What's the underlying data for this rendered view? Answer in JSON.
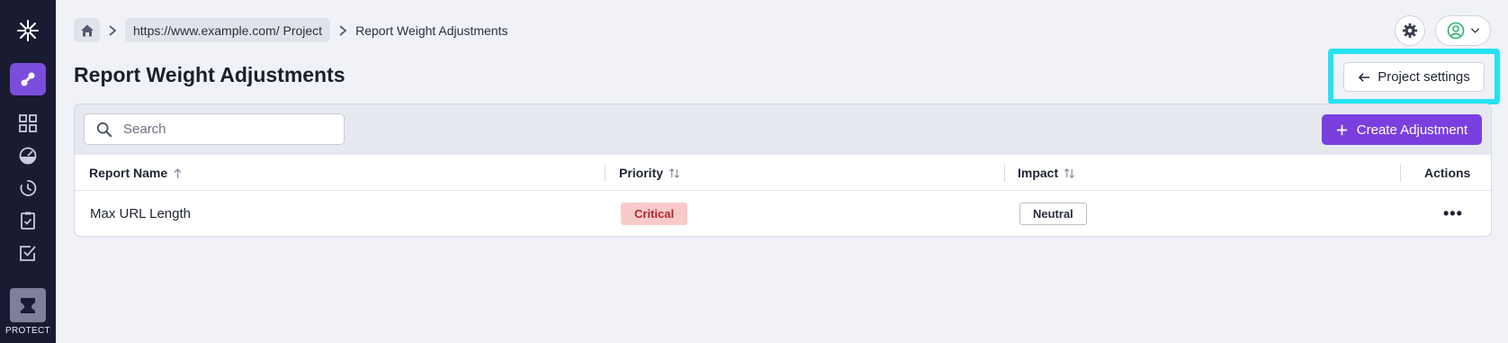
{
  "sidebar": {
    "product_label": "PROTECT",
    "items": [
      {
        "name": "link-icon",
        "active": true
      },
      {
        "name": "grid-icon",
        "active": false
      },
      {
        "name": "gauge-icon",
        "active": false
      },
      {
        "name": "history-icon",
        "active": false
      },
      {
        "name": "clipboard-check-icon",
        "active": false
      },
      {
        "name": "checkbox-icon",
        "active": false
      }
    ]
  },
  "breadcrumb": {
    "project": "https://www.example.com/ Project",
    "current": "Report Weight Adjustments"
  },
  "page": {
    "title": "Report Weight Adjustments",
    "project_settings_label": "Project settings"
  },
  "toolbar": {
    "search_placeholder": "Search",
    "search_value": "",
    "create_label": "Create Adjustment"
  },
  "table": {
    "columns": [
      "Report Name",
      "Priority",
      "Impact",
      "Actions"
    ],
    "rows": [
      {
        "report_name": "Max URL Length",
        "priority": "Critical",
        "impact": "Neutral"
      }
    ]
  },
  "colors": {
    "accent": "#7b3fe0",
    "highlight": "#26e2f2",
    "sidebar": "#191b32",
    "critical_bg": "#f8caca",
    "critical_text": "#b3262a"
  }
}
